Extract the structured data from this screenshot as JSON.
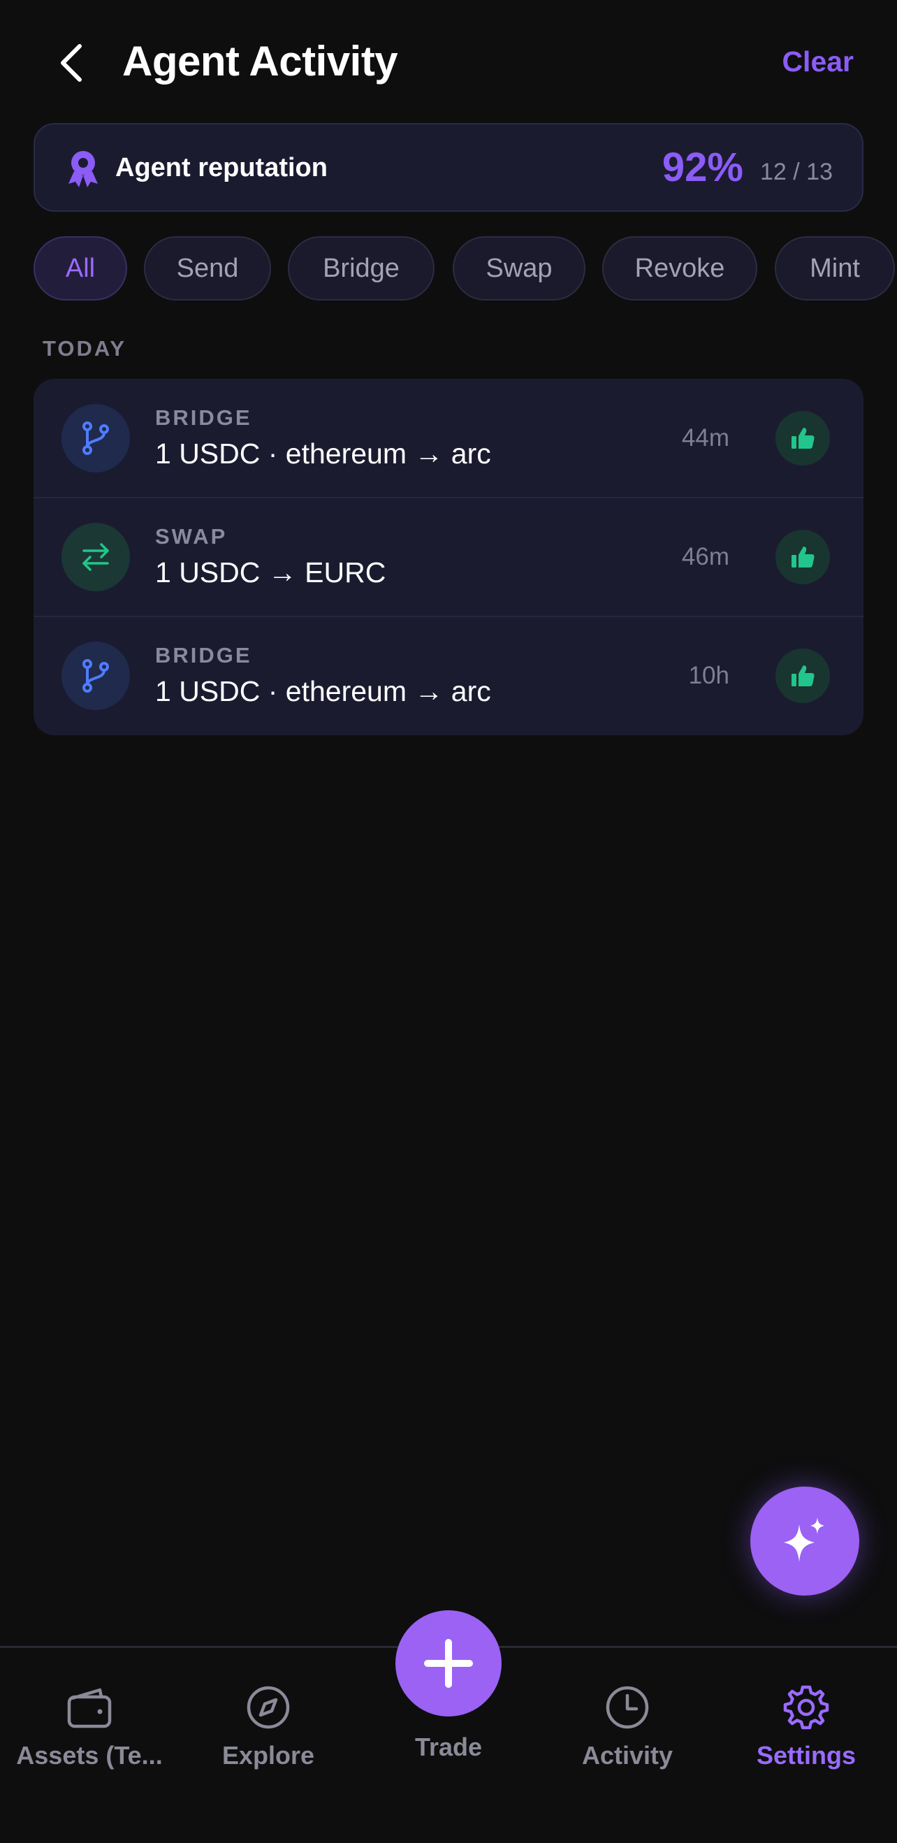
{
  "header": {
    "title": "Agent Activity",
    "clear_label": "Clear",
    "back_icon": "chevron-left-icon"
  },
  "reputation": {
    "label": "Agent reputation",
    "percent": "92%",
    "count": "12 / 13",
    "icon": "award-icon"
  },
  "filters": {
    "chips": [
      {
        "label": "All",
        "active": true
      },
      {
        "label": "Send",
        "active": false
      },
      {
        "label": "Bridge",
        "active": false
      },
      {
        "label": "Swap",
        "active": false
      },
      {
        "label": "Revoke",
        "active": false
      },
      {
        "label": "Mint",
        "active": false
      }
    ]
  },
  "section": {
    "today_label": "TODAY"
  },
  "activities": [
    {
      "type": "BRIDGE",
      "description": "1 USDC · ethereum → arc",
      "time": "44m",
      "icon": "git-branch-icon",
      "feedback_icon": "thumbs-up-icon"
    },
    {
      "type": "SWAP",
      "description": "1 USDC → EURC",
      "time": "46m",
      "icon": "swap-arrows-icon",
      "feedback_icon": "thumbs-up-icon"
    },
    {
      "type": "BRIDGE",
      "description": "1 USDC · ethereum → arc",
      "time": "10h",
      "icon": "git-branch-icon",
      "feedback_icon": "thumbs-up-icon"
    }
  ],
  "fab": {
    "icon": "sparkles-icon"
  },
  "nav": {
    "items": [
      {
        "label": "Assets (Te...",
        "icon": "wallet-icon",
        "active": false
      },
      {
        "label": "Explore",
        "icon": "compass-icon",
        "active": false
      },
      {
        "label": "Trade",
        "icon": "plus-icon",
        "active": false
      },
      {
        "label": "Activity",
        "icon": "clock-icon",
        "active": false
      },
      {
        "label": "Settings",
        "icon": "gear-icon",
        "active": true
      }
    ]
  },
  "colors": {
    "background": "#0e0e0f",
    "card": "#1b1b30",
    "accent": "#8b5cf6",
    "success": "#22c58b",
    "bridge_icon": "#4f7cff",
    "muted_text": "#8a8a98"
  }
}
